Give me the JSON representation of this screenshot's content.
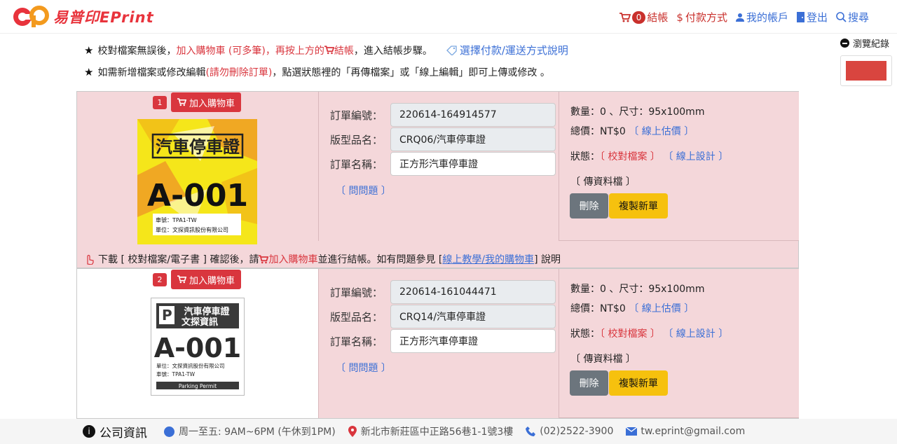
{
  "header": {
    "logo_text": "易普印",
    "logo_brand": "EPrint",
    "cart_count": "0",
    "checkout": "結帳",
    "payment": "付款方式",
    "account": "我的帳戶",
    "logout": "登出",
    "search": "搜尋"
  },
  "history": {
    "label": "瀏覽紀錄"
  },
  "notes": {
    "line1_a": "校對檔案無誤後，",
    "line1_b": "加入購物車 (可多筆)，再按上方的",
    "line1_c": "結帳",
    "line1_d": "，進入結帳步驟。",
    "help": "選擇付款/運送方式說明",
    "line2_a": "如需新增檔案或修改編輯 ",
    "line2_b": "(請勿刪除訂單)",
    "line2_c": "，點選狀態裡的「再傳檔案」或「線上編輯」即可上傳或修改 。"
  },
  "labels": {
    "add_cart": "加入購物車",
    "order_no": "訂單編號：",
    "model": "版型品名：",
    "order_name": "訂單名稱：",
    "ask": "〔 問問題 〕",
    "estimate": "〔 線上估價 〕",
    "status": "狀態：",
    "proof": "〔 校對檔案 〕",
    "design": "〔 線上設計 〕",
    "upload": "〔 傳資料檔 〕",
    "delete": "刪除",
    "copy": "複製新單"
  },
  "orders": [
    {
      "index": "1",
      "order_no": "220614-164914577",
      "model": "CRQ06/汽車停車證",
      "order_name": "正方形汽車停車證",
      "qty_size": "數量：0 、尺寸：95x100mm",
      "total": "總價：NT$0",
      "thumb_title": "汽車停車證",
      "thumb_code": "A-001",
      "thumb_line1": "車號：TPA1-TW",
      "thumb_line2": "單位：文探資訊股份有限公司"
    },
    {
      "index": "2",
      "order_no": "220614-161044471",
      "model": "CRQ14/汽車停車證",
      "order_name": "正方形汽車停車證",
      "qty_size": "數量：0 、尺寸：95x100mm",
      "total": "總價：NT$0",
      "thumb_title1": "汽車停車證",
      "thumb_title2": "文探資訊",
      "thumb_code": "A-001",
      "thumb_line1": "單位：文探資訊股份有限公司",
      "thumb_line2": "車號：TPA1-TW",
      "thumb_footer": "Parking Permit"
    }
  ],
  "download": {
    "a": "下載 [ 校對檔案/電子書 ] 確認後，請",
    "b": "加入購物車",
    "c": "並進行結帳。如有問題參見 [ ",
    "link": "線上教學/我的購物車",
    "d": " ] 說明"
  },
  "footer": {
    "title": "公司資訊",
    "hours": "周一至五: 9AM~6PM (午休到1PM)",
    "address": "新北市新莊區中正路56巷1-1號3樓",
    "phone": "(02)2522-3900",
    "email": "tw.eprint@gmail.com"
  },
  "colors": {
    "accent_red": "#d9363e",
    "link_blue": "#3b6fd6",
    "panel_pink": "#f4d7da",
    "copy_yellow": "#f6c10e"
  }
}
